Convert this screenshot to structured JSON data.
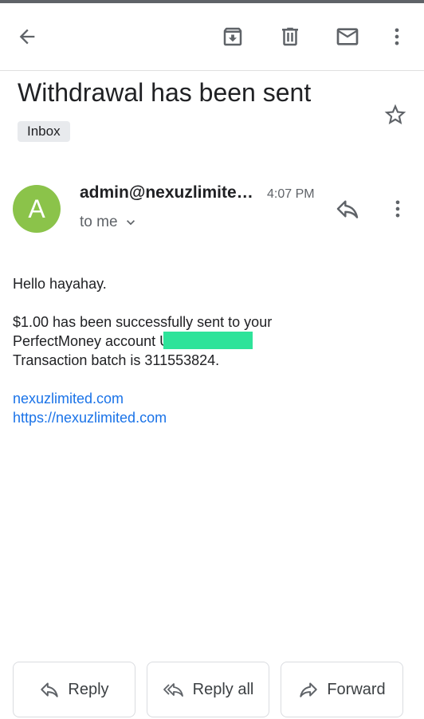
{
  "email": {
    "subject": "Withdrawal has been sent",
    "label": "Inbox",
    "sender": "admin@nexuzlimited.com",
    "time": "4:07 PM",
    "recipient": "to me",
    "avatar_letter": "A",
    "avatar_color": "#8bc34a",
    "body": {
      "greeting": "Hello hayahay.",
      "line1": "$1.00 has been successfully sent to your",
      "line2_prefix": "PerfectMoney account U",
      "line3": "Transaction batch is 311553824.",
      "link1": "nexuzlimited.com",
      "link2": "https://nexuzlimited.com"
    }
  },
  "toolbar": {
    "back_icon": "arrow-back-icon",
    "archive_icon": "archive-icon",
    "delete_icon": "trash-icon",
    "mark_unread_icon": "mail-icon",
    "more_icon": "more-vert-icon"
  },
  "actions": {
    "reply_label": "Reply",
    "reply_all_label": "Reply all",
    "forward_label": "Forward"
  },
  "colors": {
    "link": "#1a73e8",
    "redaction": "#2ee39a"
  }
}
